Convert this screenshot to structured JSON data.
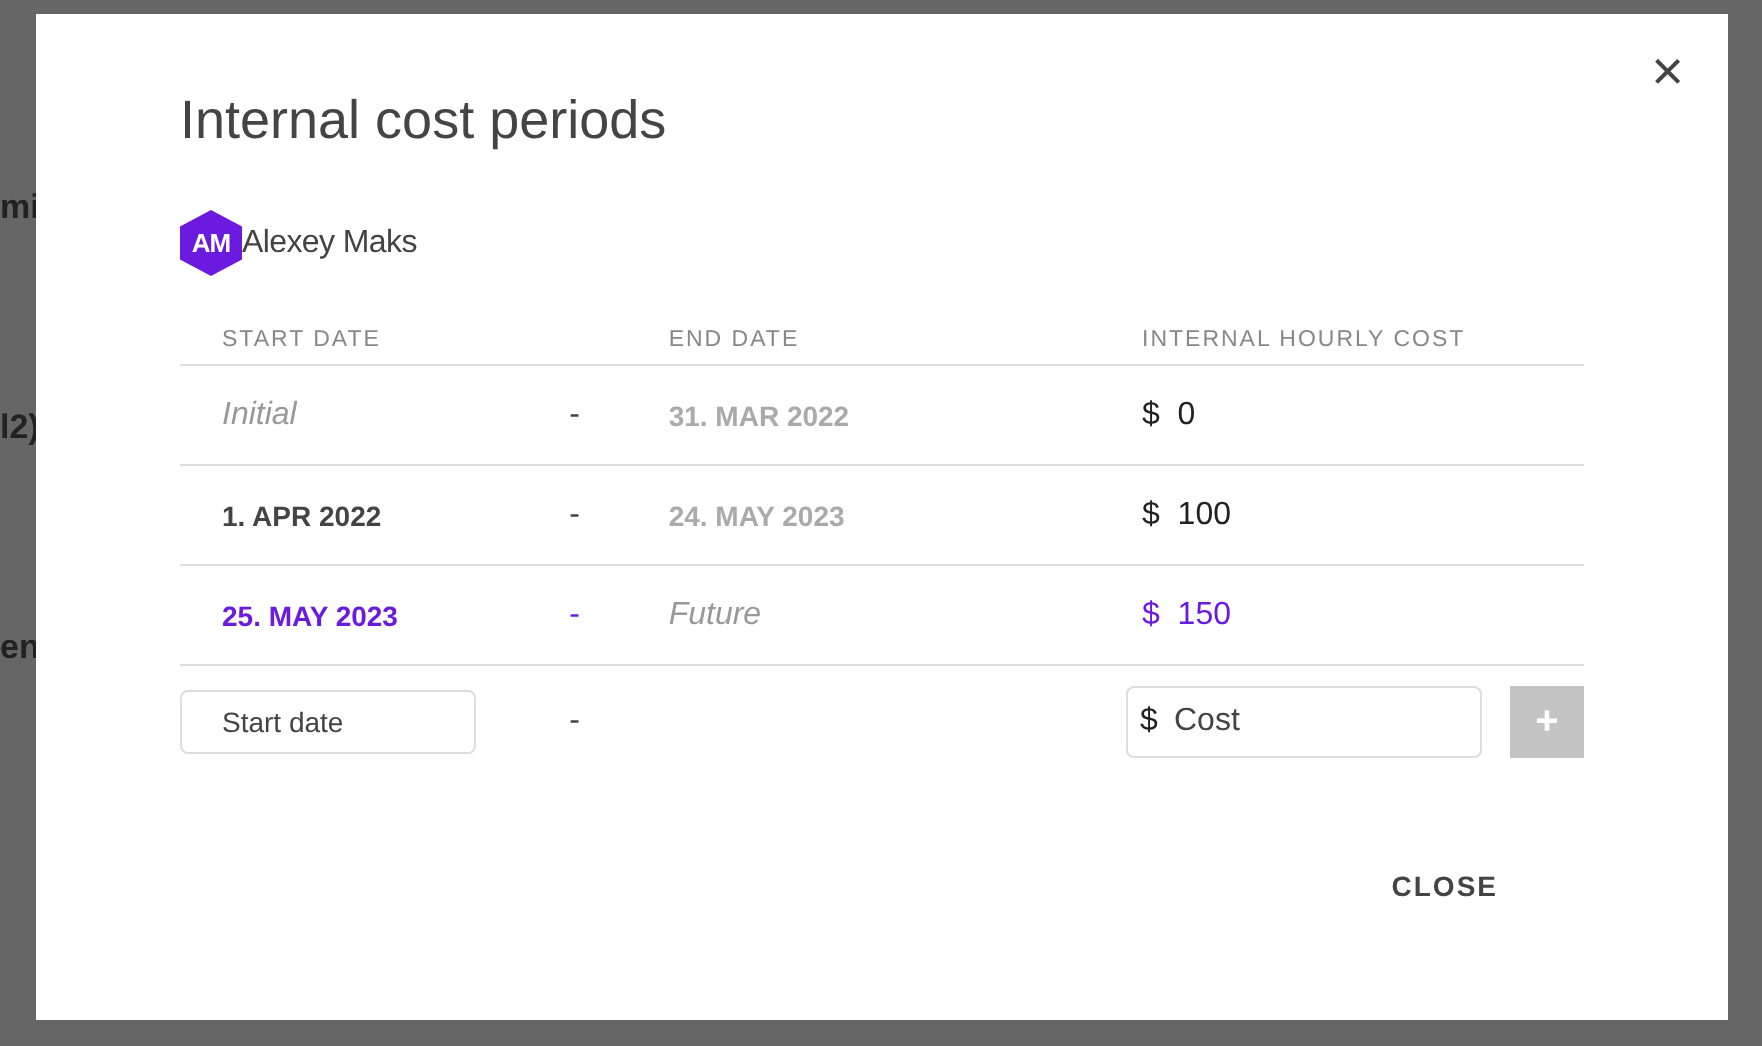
{
  "background": {
    "fragments": [
      "mi",
      "l2)",
      "en"
    ]
  },
  "dialog": {
    "title": "Internal cost periods",
    "close_icon": "×",
    "user": {
      "initials": "AM",
      "name": "Alexey Maks"
    },
    "columns": [
      "START DATE",
      "END DATE",
      "INTERNAL HOURLY COST"
    ],
    "rows": [
      {
        "start": {
          "text": "Initial",
          "kind": "open"
        },
        "separator": "-",
        "end": {
          "text": "31. MAR 2022",
          "kind": "date"
        },
        "currency": "$",
        "cost": "0",
        "current": false
      },
      {
        "start": {
          "text": "1. APR 2022",
          "kind": "date"
        },
        "separator": "-",
        "end": {
          "text": "24. MAY 2023",
          "kind": "date"
        },
        "currency": "$",
        "cost": "100",
        "current": false
      },
      {
        "start": {
          "text": "25. MAY 2023",
          "kind": "date"
        },
        "separator": "-",
        "end": {
          "text": "Future",
          "kind": "open"
        },
        "currency": "$",
        "cost": "150",
        "current": true
      }
    ],
    "new_row": {
      "start_placeholder": "Start date",
      "separator": "-",
      "currency": "$",
      "cost_placeholder": "Cost",
      "add_label": "+",
      "add_disabled": true
    },
    "close_button": "CLOSE"
  }
}
